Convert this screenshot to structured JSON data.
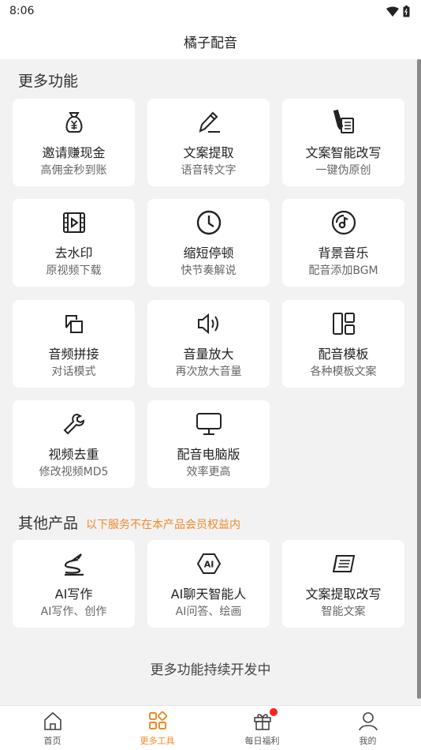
{
  "status": {
    "time": "8:06"
  },
  "header": {
    "title": "橘子配音"
  },
  "more": {
    "title": "更多功能",
    "cards": [
      {
        "name": "邀请赚现金",
        "desc": "高佣金秒到账",
        "icon": "money-bag-icon"
      },
      {
        "name": "文案提取",
        "desc": "语音转文字",
        "icon": "pen-icon"
      },
      {
        "name": "文案智能改写",
        "desc": "一键伪原创",
        "icon": "pen-note-icon"
      },
      {
        "name": "去水印",
        "desc": "原视频下载",
        "icon": "video-frame-icon"
      },
      {
        "name": "缩短停顿",
        "desc": "快节奏解说",
        "icon": "clock-icon"
      },
      {
        "name": "背景音乐",
        "desc": "配音添加BGM",
        "icon": "music-disc-icon"
      },
      {
        "name": "音频拼接",
        "desc": "对话模式",
        "icon": "merge-icon"
      },
      {
        "name": "音量放大",
        "desc": "再次放大音量",
        "icon": "speaker-icon"
      },
      {
        "name": "配音模板",
        "desc": "各种模板文案",
        "icon": "layout-icon"
      },
      {
        "name": "视频去重",
        "desc": "修改视频MD5",
        "icon": "wrench-icon"
      },
      {
        "name": "配音电脑版",
        "desc": "效率更高",
        "icon": "monitor-icon"
      }
    ]
  },
  "other": {
    "title": "其他产品",
    "subtitle": "以下服务不在本产品会员权益内",
    "cards": [
      {
        "name": "AI写作",
        "desc": "AI写作、创作",
        "icon": "ai-write-icon"
      },
      {
        "name": "AI聊天智能人",
        "desc": "AI问答、绘画",
        "icon": "ai-badge-icon"
      },
      {
        "name": "文案提取改写",
        "desc": "智能文案",
        "icon": "scroll-icon"
      }
    ]
  },
  "footer_note": "更多功能持续开发中",
  "tabs": [
    {
      "label": "首页",
      "active": false
    },
    {
      "label": "更多工具",
      "active": true
    },
    {
      "label": "每日福利",
      "active": false,
      "badge": true
    },
    {
      "label": "我的",
      "active": false
    }
  ],
  "colors": {
    "accent": "#f08a2a",
    "badge": "#ff1f1f"
  }
}
